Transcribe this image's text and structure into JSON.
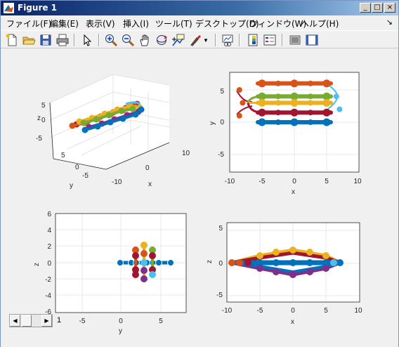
{
  "window": {
    "title": "Figure 1",
    "btn_min": "_",
    "btn_max": "□",
    "btn_close": "×"
  },
  "menubar": {
    "items": [
      "ファイル(F)",
      "編集(E)",
      "表示(V)",
      "挿入(I)",
      "ツール(T)",
      "デスクトップ(D)",
      "ウィンドウ(W)",
      "ヘルプ(H)"
    ],
    "arrow": "↘"
  },
  "toolbar": {
    "buttons": [
      "new-file-icon",
      "open-folder-icon",
      "save-icon",
      "print-icon",
      "pointer-icon",
      "zoom-in-icon",
      "zoom-out-icon",
      "pan-hand-icon",
      "rotate-3d-icon",
      "data-cursor-icon",
      "brush-icon",
      "link-plot-icon",
      "colorbar-icon",
      "legend-icon",
      "hide-plot-tools-icon",
      "show-plot-tools-icon"
    ]
  },
  "colors": {
    "blue": "#0072bd",
    "orange": "#d95319",
    "yellow": "#edb120",
    "purple": "#7e2f8e",
    "green": "#77ac30",
    "cyan": "#4dbeee",
    "red": "#a2142f"
  },
  "slider": {
    "label": "1",
    "left_arrow": "◀",
    "right_arrow": "▶"
  },
  "chart_data": [
    {
      "type": "scatter",
      "view": "3d",
      "xlabel": "x",
      "ylabel": "y",
      "zlabel": "z",
      "x_ticks": [
        "-10",
        "0",
        "10"
      ],
      "y_ticks": [
        "5",
        "0",
        "-5"
      ],
      "z_ticks": [
        "5",
        "0",
        "-5"
      ],
      "grid": true
    },
    {
      "type": "line",
      "xlabel": "x",
      "ylabel": "y",
      "xlim": [
        -10,
        10
      ],
      "ylim": [
        -8,
        8
      ],
      "x_ticks": [
        "-10",
        "-5",
        "0",
        "5",
        "10"
      ],
      "y_ticks": [
        "5",
        "0",
        "-5"
      ],
      "grid": true,
      "series": [
        {
          "color": "orange",
          "x": [
            -5,
            -2.5,
            0,
            2.5,
            5
          ],
          "y": [
            6,
            6,
            6,
            6,
            6
          ]
        },
        {
          "color": "green",
          "x": [
            -5,
            -2.5,
            0,
            2.5,
            5
          ],
          "y": [
            4,
            4,
            4,
            4,
            4
          ]
        },
        {
          "color": "yellow",
          "x": [
            -5,
            -2.5,
            0,
            2.5,
            5
          ],
          "y": [
            3,
            3,
            3,
            3,
            3
          ]
        },
        {
          "color": "red",
          "x": [
            -5,
            -2.5,
            0,
            2.5,
            5
          ],
          "y": [
            1.5,
            1.5,
            1.5,
            1.5,
            1.5
          ]
        },
        {
          "color": "blue",
          "x": [
            -5,
            -2.5,
            0,
            2.5,
            5
          ],
          "y": [
            0,
            0,
            0,
            0,
            0
          ]
        }
      ]
    },
    {
      "type": "scatter",
      "xlabel": "y",
      "ylabel": "z",
      "xlim": [
        -10,
        8
      ],
      "ylim": [
        -6,
        6
      ],
      "x_ticks": [
        "-5",
        "0",
        "5"
      ],
      "y_ticks": [
        "6",
        "4",
        "2",
        "0",
        "-2",
        "-4",
        "-6"
      ],
      "grid": true
    },
    {
      "type": "line",
      "xlabel": "x",
      "ylabel": "z",
      "xlim": [
        -10,
        10
      ],
      "ylim": [
        -6,
        6
      ],
      "x_ticks": [
        "-10",
        "-5",
        "0",
        "5",
        "10"
      ],
      "y_ticks": [
        "5",
        "0",
        "-5"
      ],
      "grid": true
    }
  ]
}
